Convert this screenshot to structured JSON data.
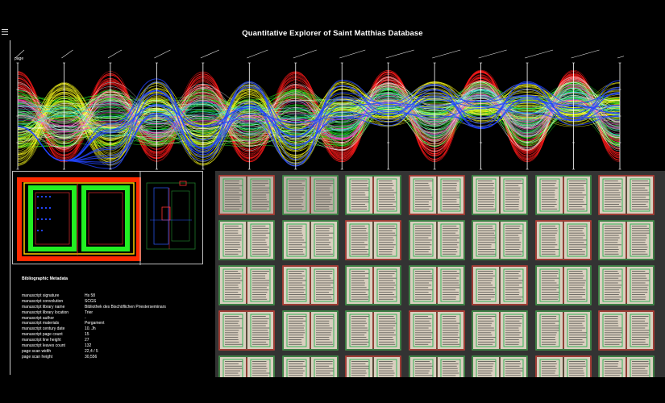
{
  "app": {
    "title": "Quantitative Explorer of Saint Matthias Database"
  },
  "parallel_coordinates": {
    "axis_labels": [
      "page",
      "",
      "",
      "",
      "",
      "",
      "",
      "",
      "",
      "",
      "",
      "",
      "",
      ""
    ],
    "band_colors": [
      "#ff1a1a",
      "#22ee22",
      "#f3f31a",
      "#2244ff",
      "#ffffff",
      "#ff33cc",
      "#22dddd",
      "#7fff00"
    ]
  },
  "layout_panel": {
    "colors": {
      "page_frame": "#ff2a00",
      "text_block": "#22ee22",
      "marker": "#2244ff"
    }
  },
  "metadata": {
    "heading": "Bibliographic Metadata",
    "rows": [
      {
        "key": "manuscript signature",
        "value": "Hs 58"
      },
      {
        "key": "manuscript convolution",
        "value": "SCGS"
      },
      {
        "key": "manuscript library name",
        "value": "Bibliothek des Bischöflichen Priesterseminars"
      },
      {
        "key": "manuscript library location",
        "value": "Trier"
      },
      {
        "key": "manuscript author",
        "value": "-"
      },
      {
        "key": "manuscript materials",
        "value": "Pergament"
      },
      {
        "key": "manuscript century date",
        "value": "10. Jh"
      },
      {
        "key": "manuscript page count",
        "value": "15"
      },
      {
        "key": "manuscript line height",
        "value": "27"
      },
      {
        "key": "manuscript leaves count",
        "value": "132"
      },
      {
        "key": "page scan width",
        "value": "22,4 / 5"
      },
      {
        "key": "page scan height",
        "value": "30,556"
      }
    ]
  },
  "gallery": {
    "rows": 5,
    "columns": 7,
    "colors": {
      "page": "#d9cfbf",
      "text_line": "#6d6a64",
      "bound_green": "#23b14d",
      "bound_red": "#e03030"
    }
  }
}
